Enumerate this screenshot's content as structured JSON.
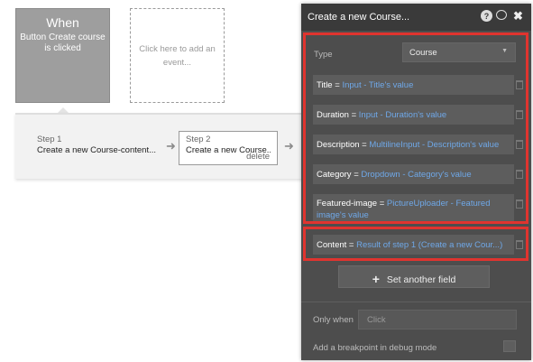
{
  "event": {
    "when_label": "When",
    "description": "Button Create course is clicked",
    "add_event_hint": "Click here to add an event..."
  },
  "steps": [
    {
      "number": "Step 1",
      "title": "Create a new Course-content..."
    },
    {
      "number": "Step 2",
      "title": "Create a new Course...",
      "delete_label": "delete"
    }
  ],
  "panel": {
    "title": "Create a new Course...",
    "type_label": "Type",
    "type_value": "Course",
    "fields": [
      {
        "name": "Title",
        "op": "=",
        "value": "Input - Title's value"
      },
      {
        "name": "Duration",
        "op": "=",
        "value": "Input - Duration's value"
      },
      {
        "name": "Description",
        "op": "=",
        "value": "MultilineInput - Description's value"
      },
      {
        "name": "Category",
        "op": "=",
        "value": "Dropdown - Category's value"
      },
      {
        "name": "Featured-image",
        "op": "=",
        "value": "PictureUploader - Featured image's value"
      },
      {
        "name": "Content",
        "op": "=",
        "value": "Result of step 1 (Create a new Cour...)"
      }
    ],
    "set_another_label": "Set another field",
    "only_when_label": "Only when",
    "only_when_placeholder": "Click",
    "breakpoint_label": "Add a breakpoint in debug mode"
  },
  "colors": {
    "highlight": "#e0342f",
    "panel_bg": "#4d4d4d",
    "dynamic_value": "#6fa8e8"
  }
}
